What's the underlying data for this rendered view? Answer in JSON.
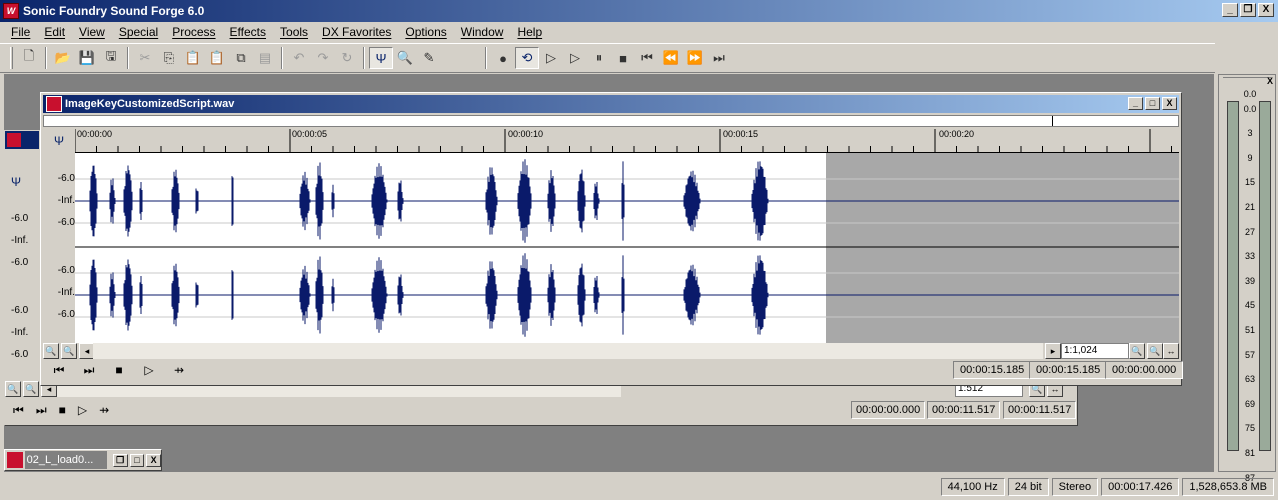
{
  "app": {
    "title": "Sonic Foundry Sound Forge 6.0",
    "minimize": "_",
    "restore": "❐",
    "close": "X"
  },
  "menu": [
    "File",
    "Edit",
    "View",
    "Special",
    "Process",
    "Effects",
    "Tools",
    "DX Favorites",
    "Options",
    "Window",
    "Help"
  ],
  "front_window": {
    "title": "ImageKeyCustomizedScript.wav",
    "ruler": [
      "00:00:00",
      "00:00:05",
      "00:00:10",
      "00:00:15",
      "00:00:20"
    ],
    "db_labels": [
      "-6.0",
      "-Inf.",
      "-6.0",
      "-6.0",
      "-Inf.",
      "-6.0"
    ],
    "zoom": "1:1,024",
    "selection_start": "00:00:15.185",
    "selection_end": "00:00:15.185",
    "selection_length": "00:00:00.000"
  },
  "back_window": {
    "title": "02_L_load",
    "db_labels": [
      "-6.0",
      "-Inf.",
      "-6.0",
      "-6.0",
      "-Inf.",
      "-6.0"
    ],
    "zoom": "1:512",
    "selection_start": "00:00:00.000",
    "selection_end": "00:00:11.517",
    "selection_length": "00:00:11.517"
  },
  "minimized_window": {
    "title": "02_L_load0..."
  },
  "meter": {
    "labels": [
      "0.0",
      "0.0",
      "3",
      "9",
      "15",
      "21",
      "27",
      "33",
      "39",
      "45",
      "51",
      "57",
      "63",
      "69",
      "75",
      "81",
      "87"
    ]
  },
  "status": {
    "sample_rate": "44,100 Hz",
    "bit_depth": "24 bit",
    "channels": "Stereo",
    "length": "00:00:17.426",
    "disk_space": "1,528,653.8 MB"
  },
  "colors": {
    "waveform": "#0a1a6a",
    "title_active": "#0a246a",
    "unused_region": "#a8a8a8"
  }
}
